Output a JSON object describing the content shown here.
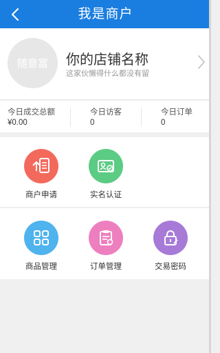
{
  "header": {
    "title": "我是商户",
    "back_icon": "chevron-left-icon"
  },
  "store": {
    "avatar_text": "随意富",
    "name": "你的店铺名称",
    "description": "这家伙懒得什么都没有留",
    "arrow_icon": "chevron-right-icon"
  },
  "stats": [
    {
      "label": "今日成交总额",
      "value": "¥0.00"
    },
    {
      "label": "今日访客",
      "value": "0"
    },
    {
      "label": "今日订单",
      "value": "0"
    }
  ],
  "tiles": [
    {
      "label": "商户申请",
      "icon": "merchant-apply-icon",
      "color": "#f36a5d"
    },
    {
      "label": "实名认证",
      "icon": "id-card-icon",
      "color": "#5ccb84"
    },
    {
      "label": "商品管理",
      "icon": "grid-icon",
      "color": "#4fb3ee"
    },
    {
      "label": "订单管理",
      "icon": "order-clipboard-icon",
      "color": "#ee7fbf"
    },
    {
      "label": "交易密码",
      "icon": "lock-icon",
      "color": "#a77ad8"
    }
  ]
}
